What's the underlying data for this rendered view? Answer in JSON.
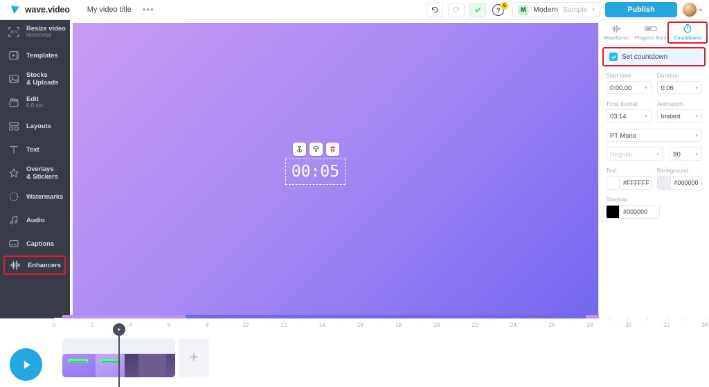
{
  "app": {
    "brand_name": "wave.video",
    "video_title": "My video title",
    "more_menu": "•••"
  },
  "topbar": {
    "undo_icon": "undo-icon",
    "redo_icon": "redo-icon",
    "check_icon": "check-icon",
    "help_icon": "help-icon",
    "help_badge_count": "6",
    "brand_kit": {
      "badge": "M",
      "name": "Modern",
      "sample": "Sample"
    },
    "publish_label": "Publish",
    "avatar": "user-avatar"
  },
  "sidebar": {
    "items": [
      {
        "icon": "resize-16-9-icon",
        "label": "Resize video",
        "sub": "Horizontal"
      },
      {
        "icon": "templates-icon",
        "label": "Templates",
        "sub": ""
      },
      {
        "icon": "stocks-uploads-icon",
        "label": "Stocks",
        "sub": "& Uploads"
      },
      {
        "icon": "edit-clapper-icon",
        "label": "Edit",
        "sub": "6.0 sec"
      },
      {
        "icon": "layouts-icon",
        "label": "Layouts",
        "sub": ""
      },
      {
        "icon": "text-icon",
        "label": "Text",
        "sub": ""
      },
      {
        "icon": "overlays-stickers-icon",
        "label": "Overlays",
        "sub": "& Stickers"
      },
      {
        "icon": "watermarks-icon",
        "label": "Watermarks",
        "sub": ""
      },
      {
        "icon": "audio-icon",
        "label": "Audio",
        "sub": ""
      },
      {
        "icon": "captions-icon",
        "label": "Captions",
        "sub": ""
      },
      {
        "icon": "enhancers-icon",
        "label": "Enhancers",
        "sub": ""
      }
    ],
    "active_index": 10
  },
  "canvas": {
    "countdown_value": "00:05",
    "element_toolbar": [
      {
        "icon": "anchor-icon",
        "name": "anchor-button"
      },
      {
        "icon": "duplicate-icon",
        "name": "duplicate-button"
      },
      {
        "icon": "trash-icon",
        "name": "delete-button"
      }
    ],
    "gradient_start": "#C89BF5",
    "gradient_end": "#7366F0"
  },
  "panel": {
    "tabs": [
      {
        "label": "Waveforms",
        "icon": "waveform-icon",
        "active": false
      },
      {
        "label": "Progress Bars",
        "icon": "progress-bar-icon",
        "active": false
      },
      {
        "label": "Countdowns",
        "icon": "stopwatch-icon",
        "active": true
      }
    ],
    "set_countdown_label": "Set countdown",
    "set_countdown_checked": true,
    "start_time": {
      "label": "Start time",
      "value": "0:00.00"
    },
    "duration": {
      "label": "Duration",
      "value": "0:06"
    },
    "time_format": {
      "label": "Time format",
      "value": "03:14"
    },
    "animation": {
      "label": "Animation",
      "value": "Instant"
    },
    "font_family": {
      "value": "PT Mono"
    },
    "font_weight": {
      "value": "Regular"
    },
    "font_size": {
      "value": "80"
    },
    "text_color": {
      "label": "Text",
      "value": "#FFFFFF"
    },
    "background_color": {
      "label": "Background",
      "value": "#000000"
    },
    "shadow_color": {
      "label": "Shadow",
      "value": "#000000"
    },
    "accent_color": "#22A7E0",
    "highlight_color": "#E8192C"
  },
  "timeline": {
    "ruler_ticks": [
      "0",
      "2",
      "4",
      "6",
      "8",
      "10",
      "12",
      "14",
      "16",
      "18",
      "20",
      "22",
      "24",
      "26",
      "28",
      "30",
      "32",
      "34"
    ],
    "add_clip_label": "+",
    "play_button": "play-button",
    "playhead_position": "3"
  }
}
